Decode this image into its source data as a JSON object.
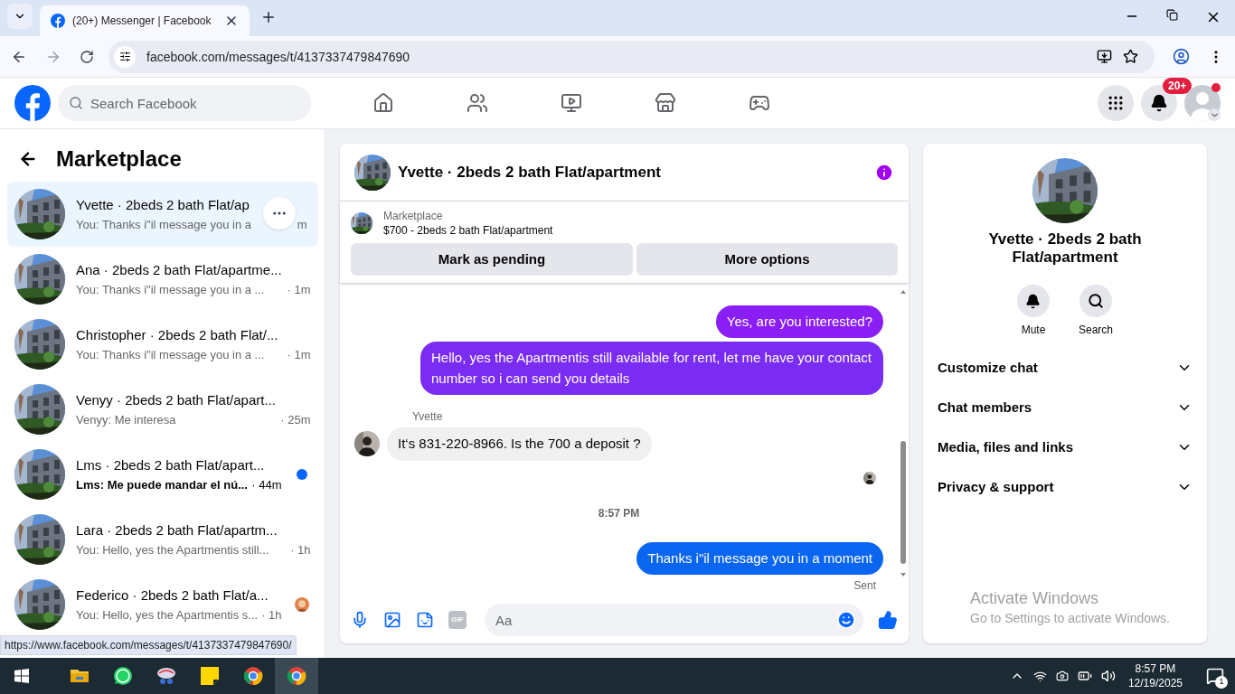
{
  "browser": {
    "tabs": [
      {
        "title": "(20+) Messenger | Facebook",
        "selected": true
      }
    ],
    "url": "facebook.com/messages/t/4137337479847690",
    "status_url": "https://www.facebook.com/messages/t/4137337479847690/"
  },
  "topbar": {
    "search_placeholder": "Search Facebook",
    "notification_badge": "20+"
  },
  "sidebar": {
    "title": "Marketplace",
    "conversations": [
      {
        "title": "Yvette · 2beds 2 bath Flat/ap",
        "preview": "You: Thanks i\"il message you in a",
        "time": "m",
        "selected": true,
        "unread": false,
        "kind": "hovered"
      },
      {
        "title": "Ana · 2beds 2 bath Flat/apartme...",
        "preview": "You: Thanks i\"il message you in a ...",
        "time": "· 1m",
        "selected": false,
        "unread": false,
        "kind": "plain"
      },
      {
        "title": "Christopher · 2beds 2 bath Flat/...",
        "preview": "You: Thanks i\"il message you in a ...",
        "time": "· 1m",
        "selected": false,
        "unread": false,
        "kind": "plain"
      },
      {
        "title": "Venyy · 2beds 2 bath Flat/apart...",
        "preview": "Venyy: Me interesa",
        "time": "· 25m",
        "selected": false,
        "unread": false,
        "kind": "plain"
      },
      {
        "title": "Lms · 2beds 2 bath Flat/apart...",
        "preview": "Lms: Me puede mandar el nú...",
        "time": "· 44m",
        "selected": false,
        "unread": true,
        "kind": "plain"
      },
      {
        "title": "Lara · 2beds 2 bath Flat/apartm...",
        "preview": "You: Hello, yes the Apartmentis still...",
        "time": "· 1h",
        "selected": false,
        "unread": false,
        "kind": "plain"
      },
      {
        "title": "Federico · 2beds 2 bath Flat/a...",
        "preview": "You: Hello, yes the Apartmentis s...",
        "time": "· 1h",
        "selected": false,
        "unread": false,
        "kind": "seen"
      }
    ]
  },
  "chat": {
    "title": "Yvette · 2beds 2 bath Flat/apartment",
    "listing": {
      "label": "Marketplace",
      "title": "$700 - 2beds 2 bath Flat/apartment"
    },
    "buttons": [
      "Mark as pending",
      "More options"
    ],
    "messages": [
      {
        "kind": "outgoing",
        "text": "Yes, are you interested?",
        "color": "#8a1ef5"
      },
      {
        "kind": "outgoing",
        "text": "Hello, yes the Apartmentis still available for rent, let me have your contact number so i can send you  details",
        "color": "#7b2cf3"
      },
      {
        "kind": "incoming",
        "sender": "Yvette",
        "text": "It‘s 831-220-8966. Is the 700 a deposit ?"
      },
      {
        "kind": "seen"
      },
      {
        "kind": "timestamp",
        "text": "8:57 PM"
      },
      {
        "kind": "outgoing",
        "text": "Thanks i\"il message you in a moment",
        "color": "#0a66f0"
      },
      {
        "kind": "status",
        "text": "Sent"
      }
    ],
    "gif_label": "GIF",
    "composer_placeholder": "Aa"
  },
  "info_panel": {
    "title": "Yvette · 2beds 2 bath Flat/apartment",
    "actions": [
      {
        "kind": "mute",
        "label": "Mute"
      },
      {
        "kind": "search",
        "label": "Search"
      }
    ],
    "sections": [
      {
        "label": "Customize chat",
        "expanded": false
      },
      {
        "label": "Chat members",
        "expanded": false
      },
      {
        "label": "Media, files and links",
        "expanded": false
      },
      {
        "label": "Privacy & support",
        "expanded": false
      }
    ]
  },
  "activation_notice": {
    "title": "Activate Windows",
    "text": "Go to Settings to activate Windows."
  },
  "taskbar": {
    "time": "8:57 PM",
    "date": "12/19/2025",
    "notification_count": "1"
  }
}
